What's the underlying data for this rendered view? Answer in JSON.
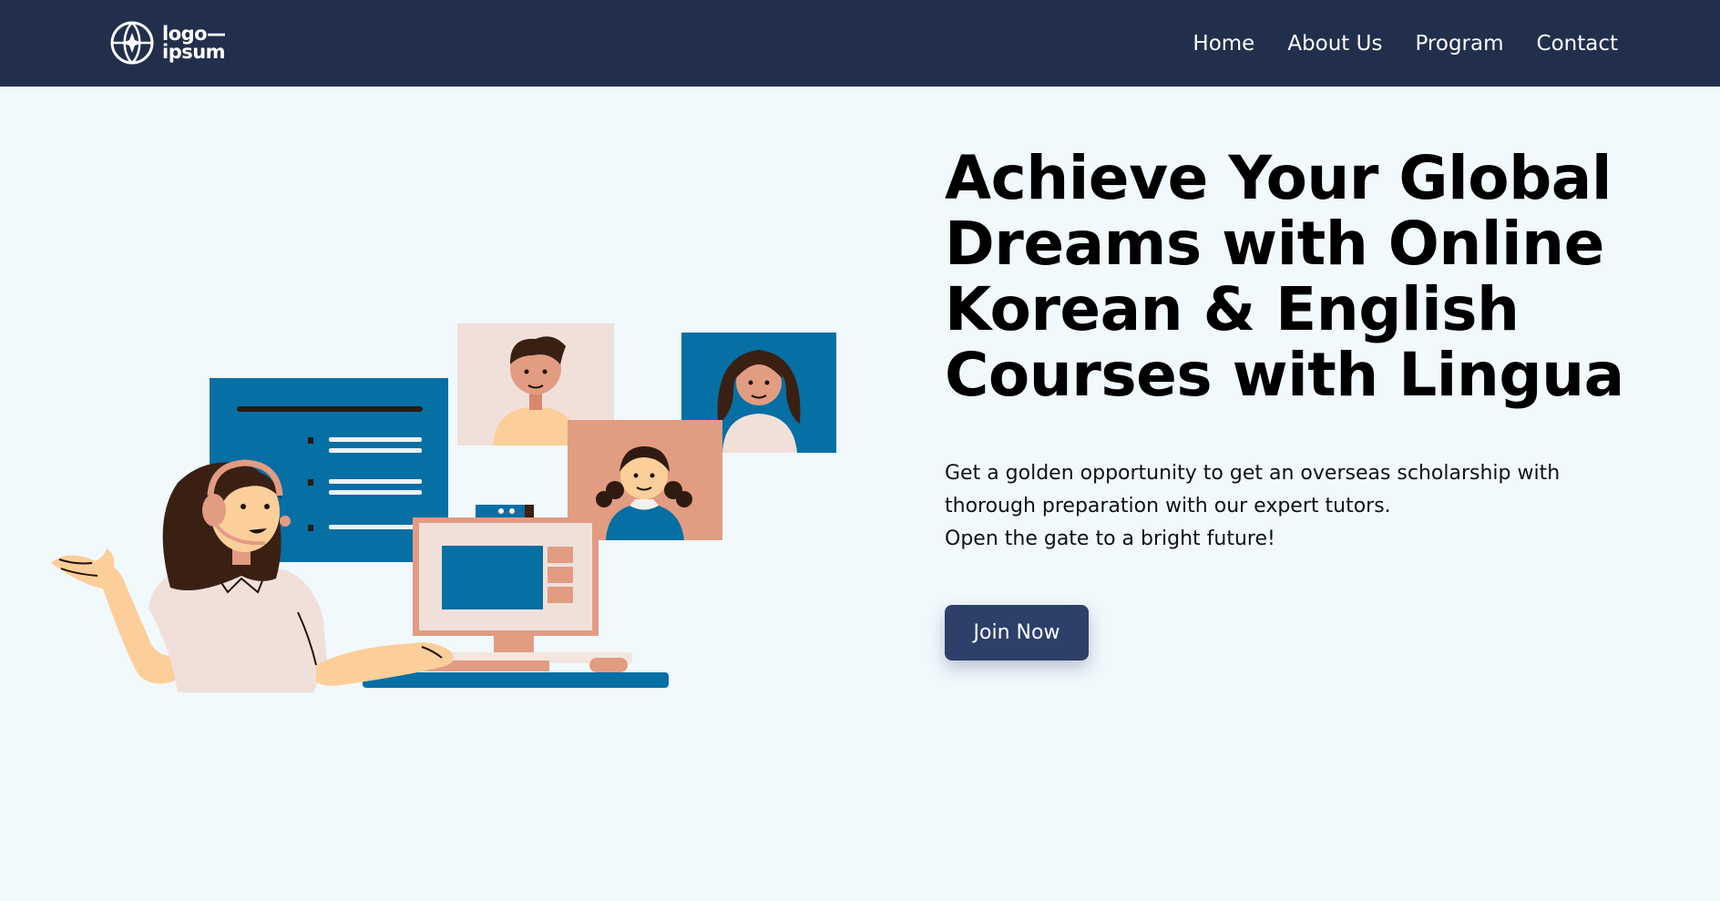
{
  "header": {
    "logo": {
      "line1": "logo—",
      "line2": "ipsum",
      "icon": "globe-star-icon"
    },
    "nav": [
      {
        "label": "Home"
      },
      {
        "label": "About Us"
      },
      {
        "label": "Program"
      },
      {
        "label": "Contact"
      }
    ]
  },
  "hero": {
    "title": "Achieve Your Global Dreams with Online Korean & English Courses with Lingua",
    "description_line1": "Get a golden opportunity to get an overseas scholarship with thorough preparation with our expert tutors.",
    "description_line2": "Open the gate to a bright future!",
    "cta_label": "Join Now"
  },
  "colors": {
    "nav_bg": "#212f4c",
    "page_bg": "#f1f9fd",
    "button_bg": "#2d406a",
    "illustration_blue": "#066fa4",
    "illustration_salmon": "#e29c82"
  }
}
